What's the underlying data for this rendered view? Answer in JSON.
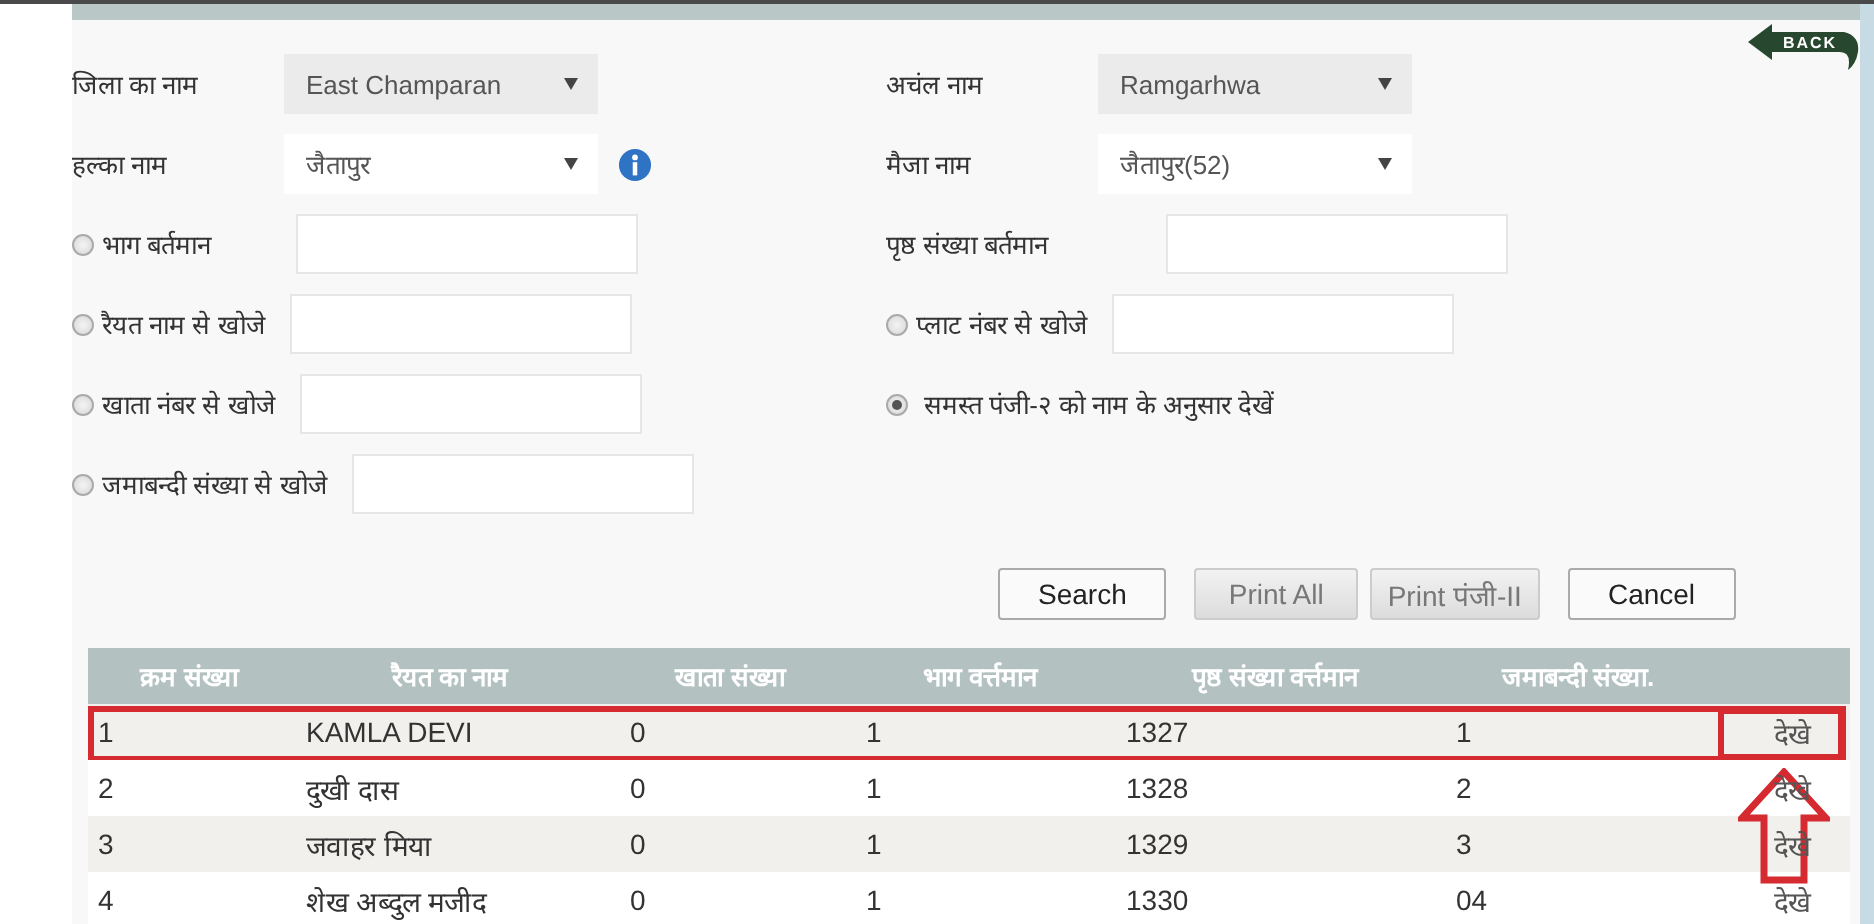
{
  "back_button": {
    "label": "BACK"
  },
  "form": {
    "rows": [
      [
        {
          "kind": "select",
          "label": "जिला का नाम",
          "value": "East Champaran",
          "disabled": true
        },
        {
          "kind": "select",
          "label": "अचंल नाम",
          "value": "Ramgarhwa",
          "disabled": true
        }
      ],
      [
        {
          "kind": "select",
          "label": "हल्का नाम",
          "value": "जैतापुर",
          "disabled": false,
          "info_icon": true
        },
        {
          "kind": "select",
          "label": "मैजा नाम",
          "value": "जैतापुर(52)",
          "disabled": false
        }
      ],
      [
        {
          "kind": "radio_text",
          "label": "भाग बर्तमान",
          "selected": false
        },
        {
          "kind": "text",
          "label": "पृष्ठ संख्या बर्तमान"
        }
      ],
      [
        {
          "kind": "radio_text",
          "label": "रैयत नाम से खोजे",
          "selected": false
        },
        {
          "kind": "radio_text",
          "label": "प्लाट नंबर से खोजे",
          "selected": false
        }
      ],
      [
        {
          "kind": "radio_text",
          "label": "खाता नंबर से खोजे",
          "selected": false
        },
        {
          "kind": "radio",
          "label": "समस्त पंजी-२ को नाम के अनुसार देखें",
          "selected": true
        }
      ],
      [
        {
          "kind": "radio_text",
          "label": "जमाबन्दी संख्या से खोजे",
          "selected": false
        }
      ]
    ]
  },
  "buttons": [
    {
      "label": "Search",
      "disabled": false
    },
    {
      "label": "Print All",
      "disabled": true
    },
    {
      "label": "Print पंजी-II",
      "disabled": true
    },
    {
      "label": "Cancel",
      "disabled": false
    }
  ],
  "table": {
    "columns": [
      "क्रम संख्या",
      "रैयत का नाम",
      "खाता संख्या",
      "भाग वर्त्तमान",
      "पृष्ठ संख्या वर्त्तमान",
      "जमाबन्दी संख्या."
    ],
    "rows": [
      {
        "cells": [
          "1",
          "KAMLA DEVI",
          "0",
          "1",
          "1327",
          "1"
        ],
        "action": "देखे",
        "highlighted": true
      },
      {
        "cells": [
          "2",
          "दुखी दास",
          "0",
          "1",
          "1328",
          "2"
        ],
        "action": "देखे",
        "highlighted": false
      },
      {
        "cells": [
          "3",
          "जवाहर मिया",
          "0",
          "1",
          "1329",
          "3"
        ],
        "action": "देखे",
        "highlighted": false
      },
      {
        "cells": [
          "4",
          "शेख अब्दुल मजीद",
          "0",
          "1",
          "1330",
          "04"
        ],
        "action": "देखे",
        "highlighted": false
      }
    ]
  }
}
